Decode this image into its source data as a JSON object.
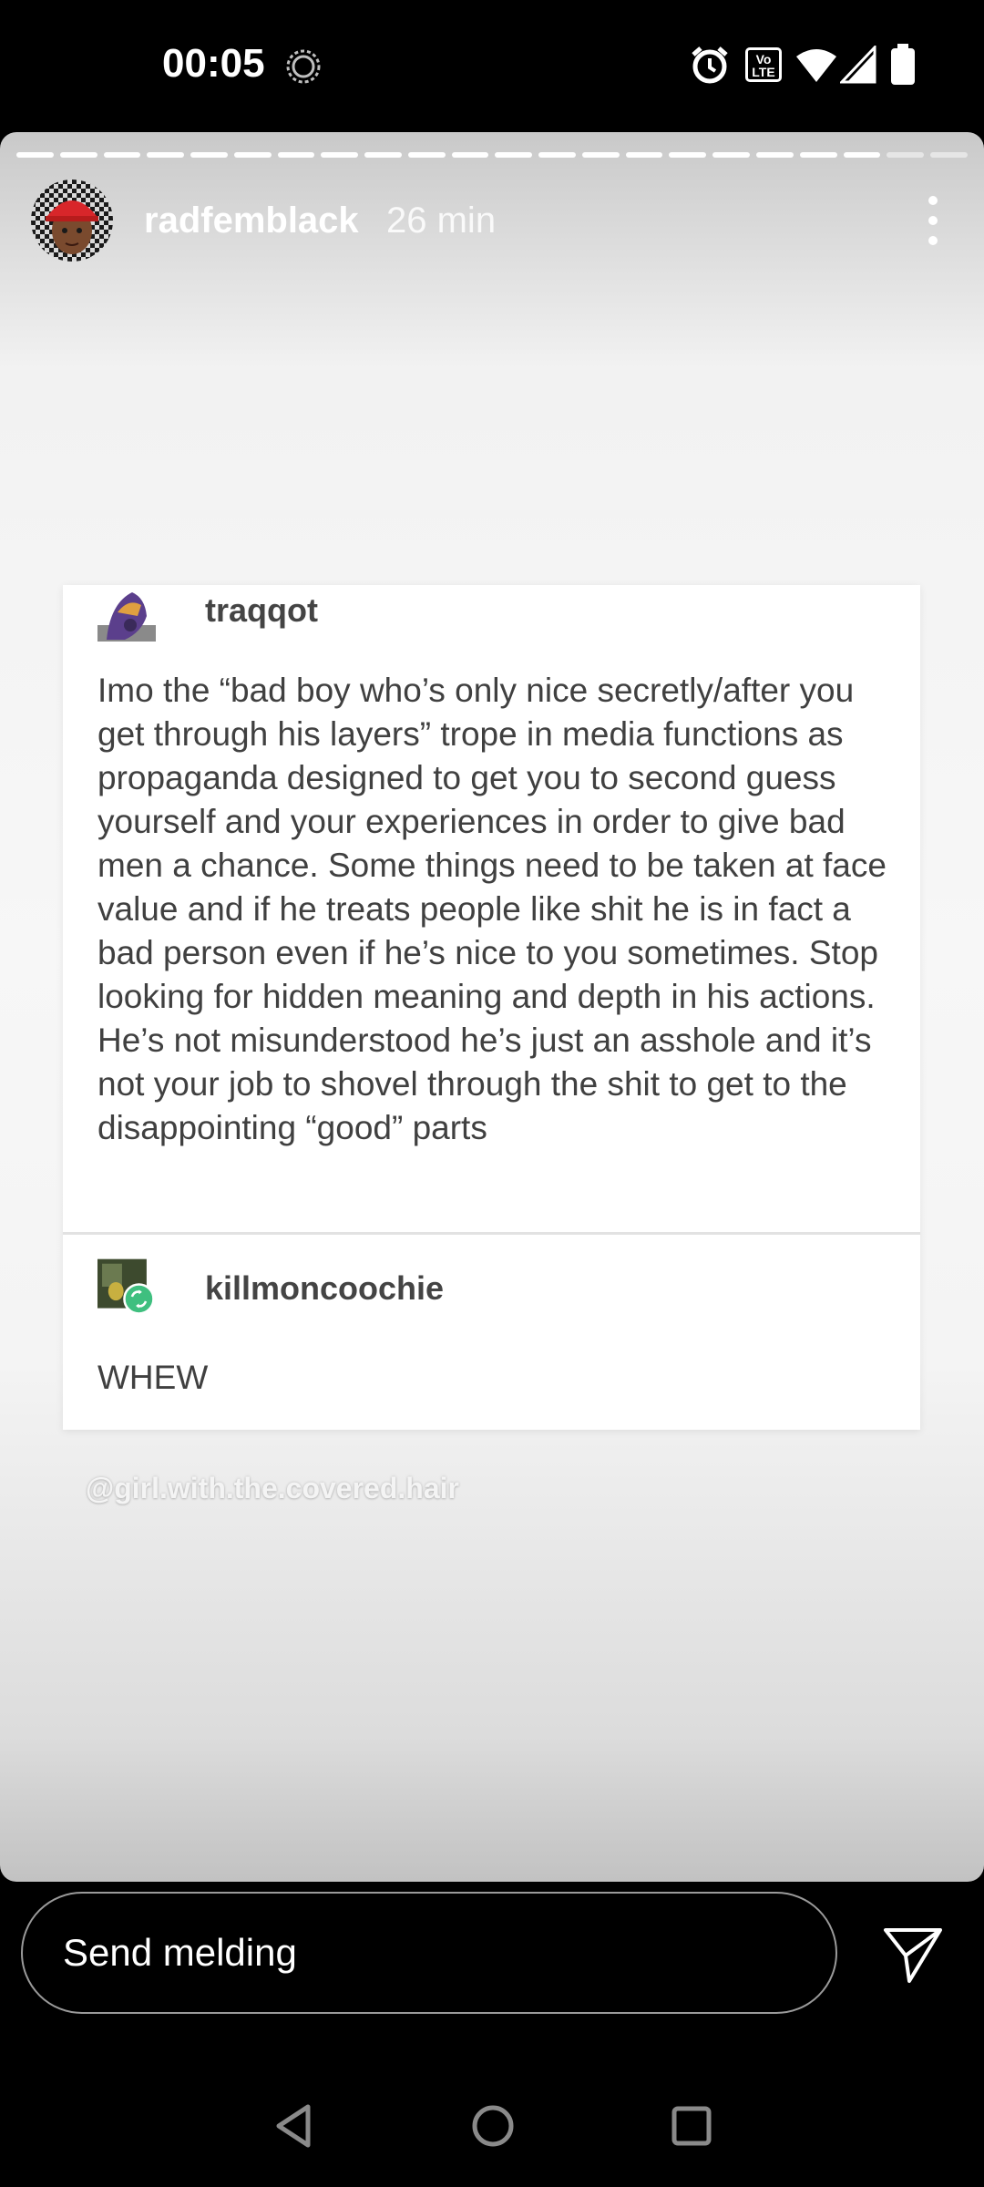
{
  "status_bar": {
    "time": "00:05",
    "icons": [
      "settings-gear-icon",
      "alarm-icon",
      "volte-icon",
      "wifi-icon",
      "signal-icon",
      "battery-icon"
    ],
    "volte_label": "Vo LTE"
  },
  "story": {
    "segment_count": 22,
    "segments_complete": 20,
    "username": "radfemblack",
    "time_ago": "26 min"
  },
  "post": {
    "author": "traqqot",
    "text": "Imo the “bad boy who’s only nice secretly/after you get through his layers” trope in media functions as propaganda designed to get you to second guess yourself and your experiences in order to give bad men a chance. Some things need to be taken at face value and if he treats people like shit he is in fact a bad person even if he’s nice to you sometimes. Stop looking for hidden meaning and depth in his actions. He’s not misunderstood he’s just an asshole and it’s not your job to shovel through the shit to get to the disappointing “good” parts",
    "reblog_author": "killmoncoochie",
    "reblog_text": "WHEW"
  },
  "watermark": "@girl.with.the.covered.hair",
  "reply": {
    "placeholder": "Send melding"
  },
  "colors": {
    "background": "#000000",
    "story_bg": "#f4f4f4",
    "card_bg": "#ffffff",
    "body_text": "#404040",
    "reblog_badge": "#3fbf7f"
  }
}
